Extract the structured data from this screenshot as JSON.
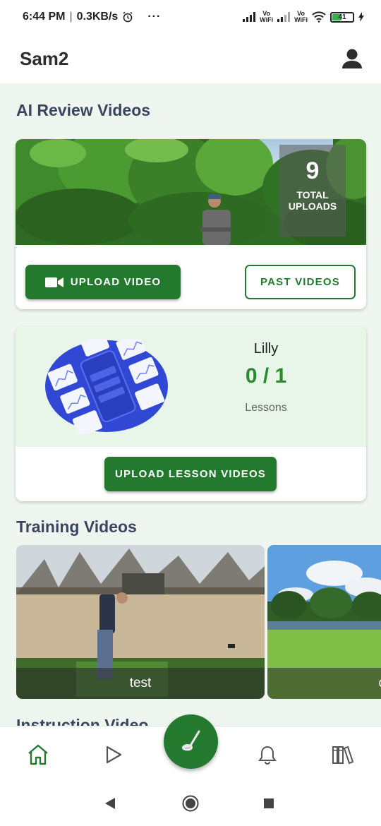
{
  "status_bar": {
    "time": "6:44 PM",
    "speed": "0.3KB/s",
    "more": "···",
    "vowifi_top": "Vo",
    "vowifi_bottom": "WiFi",
    "battery": "41"
  },
  "header": {
    "title": "Sam2",
    "profile_icon": "person-icon"
  },
  "ai_review": {
    "title": "AI Review Videos",
    "total_uploads_count": "9",
    "total_uploads_label_1": "TOTAL",
    "total_uploads_label_2": "UPLOADS",
    "upload_button": "UPLOAD VIDEO",
    "past_button": "PAST VIDEOS"
  },
  "lessons": {
    "coach_name": "Lilly",
    "count": "0 / 1",
    "label": "Lessons",
    "upload_button": "UPLOAD LESSON VIDEOS"
  },
  "training": {
    "title": "Training Videos",
    "videos": [
      {
        "caption": "test"
      },
      {
        "caption": "c"
      }
    ]
  },
  "instruction": {
    "title": "Instruction Video"
  },
  "bottom_nav": {
    "items": [
      "home-icon",
      "play-icon",
      "golf-club-icon",
      "bell-icon",
      "library-icon"
    ]
  },
  "colors": {
    "brand_green": "#237a2f",
    "accent_green": "#2b8a2f",
    "background": "#eef6ef",
    "title_navy": "#3a4560"
  }
}
